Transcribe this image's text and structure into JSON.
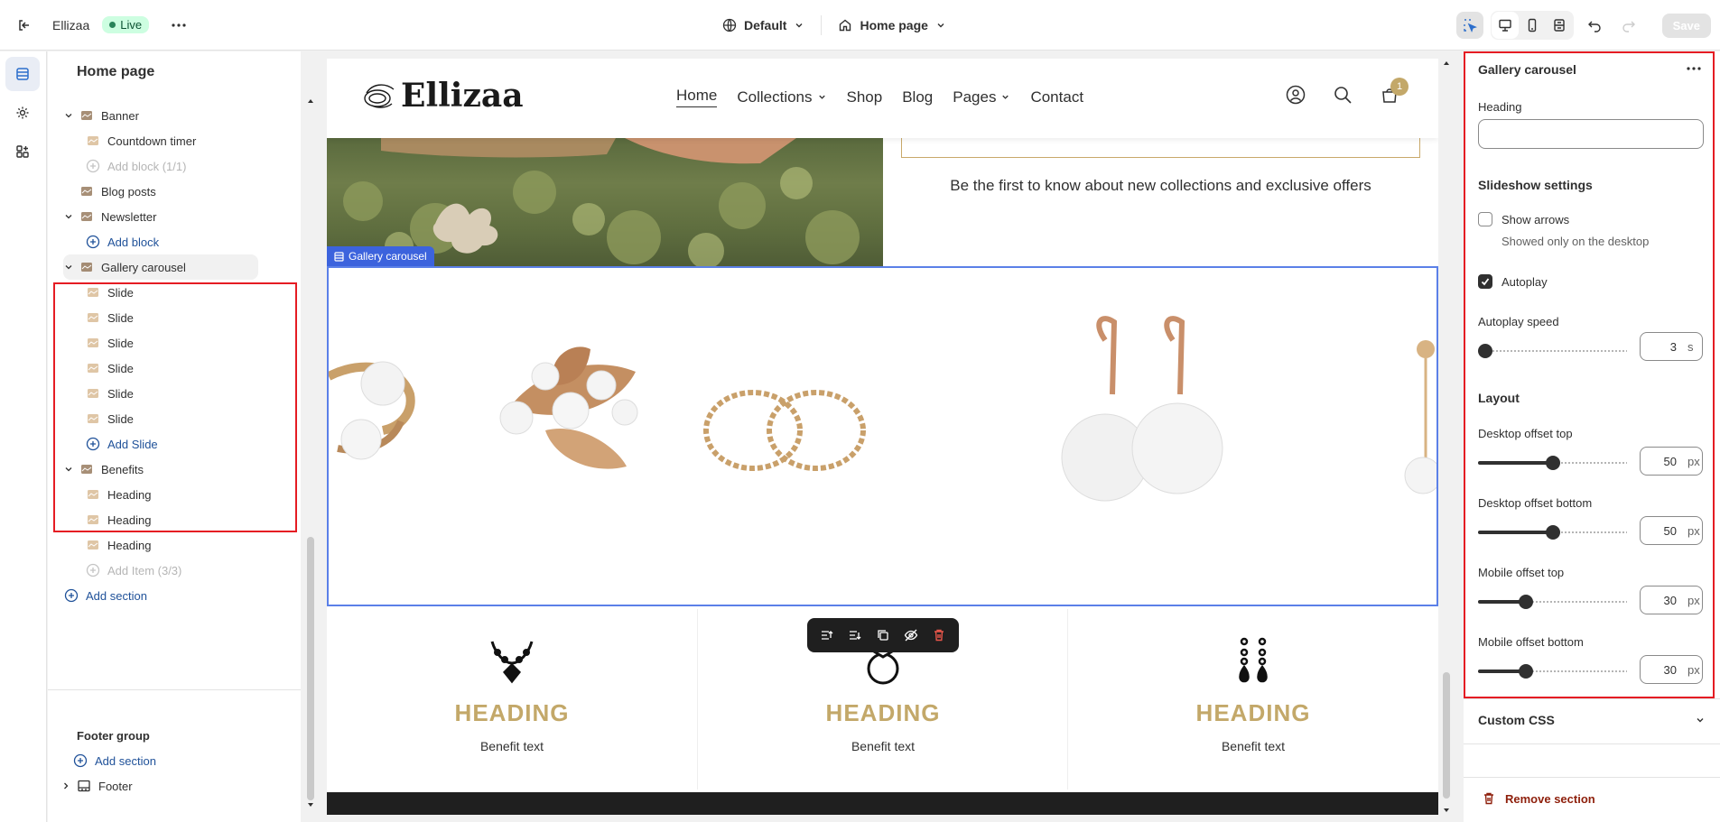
{
  "topbar": {
    "store_name": "Ellizaa",
    "status": "Live",
    "theme": "Default",
    "page": "Home page",
    "save_label": "Save"
  },
  "sidebar": {
    "title": "Home page",
    "items": [
      {
        "label": "Banner",
        "level": 0,
        "type": "section",
        "expanded": true
      },
      {
        "label": "Countdown timer",
        "level": 1,
        "type": "block"
      },
      {
        "label": "Add block (1/1)",
        "level": 1,
        "type": "add-disabled"
      },
      {
        "label": "Blog posts",
        "level": 0,
        "type": "section"
      },
      {
        "label": "Newsletter",
        "level": 0,
        "type": "section",
        "expanded": true
      },
      {
        "label": "Add block",
        "level": 1,
        "type": "add"
      },
      {
        "label": "Gallery carousel",
        "level": 0,
        "type": "section",
        "expanded": true,
        "selected": true
      },
      {
        "label": "Slide",
        "level": 1,
        "type": "block"
      },
      {
        "label": "Slide",
        "level": 1,
        "type": "block"
      },
      {
        "label": "Slide",
        "level": 1,
        "type": "block"
      },
      {
        "label": "Slide",
        "level": 1,
        "type": "block"
      },
      {
        "label": "Slide",
        "level": 1,
        "type": "block"
      },
      {
        "label": "Slide",
        "level": 1,
        "type": "block"
      },
      {
        "label": "Add Slide",
        "level": 1,
        "type": "add"
      },
      {
        "label": "Benefits",
        "level": 0,
        "type": "section",
        "expanded": true
      },
      {
        "label": "Heading",
        "level": 1,
        "type": "block"
      },
      {
        "label": "Heading",
        "level": 1,
        "type": "block"
      },
      {
        "label": "Heading",
        "level": 1,
        "type": "block"
      },
      {
        "label": "Add Item (3/3)",
        "level": 1,
        "type": "add-disabled"
      },
      {
        "label": "Add section",
        "level": 0,
        "type": "add"
      }
    ],
    "footer_group_title": "Footer group",
    "footer_add_section": "Add section",
    "footer_item": "Footer"
  },
  "preview": {
    "logo": "Ellizaa",
    "nav": [
      "Home",
      "Collections",
      "Shop",
      "Blog",
      "Pages",
      "Contact"
    ],
    "cart_count": "1",
    "newsletter_text": "Be the first to know about new collections and exclusive offers",
    "gallery_label": "Gallery carousel",
    "benefits": [
      {
        "heading": "HEADING",
        "text": "Benefit text",
        "icon": "necklace-icon"
      },
      {
        "heading": "HEADING",
        "text": "Benefit text",
        "icon": "ring-icon"
      },
      {
        "heading": "HEADING",
        "text": "Benefit text",
        "icon": "earrings-icon"
      }
    ]
  },
  "settings": {
    "title": "Gallery carousel",
    "heading_label": "Heading",
    "heading_value": "",
    "slideshow_title": "Slideshow settings",
    "show_arrows_label": "Show arrows",
    "show_arrows_help": "Showed only on the desktop",
    "show_arrows_checked": false,
    "autoplay_label": "Autoplay",
    "autoplay_checked": true,
    "autoplay_speed_label": "Autoplay speed",
    "autoplay_speed_value": "3",
    "autoplay_speed_unit": "s",
    "layout_title": "Layout",
    "desktop_top_label": "Desktop offset top",
    "desktop_top_value": "50",
    "desktop_bottom_label": "Desktop offset bottom",
    "desktop_bottom_value": "50",
    "mobile_top_label": "Mobile offset top",
    "mobile_top_value": "30",
    "mobile_bottom_label": "Mobile offset bottom",
    "mobile_bottom_value": "30",
    "px_unit": "px",
    "custom_css_label": "Custom CSS",
    "remove_label": "Remove section"
  },
  "colors": {
    "accent_blue": "#3c63dd",
    "highlight_red": "#e51c23",
    "gold": "#c3a869",
    "danger": "#8e1f0b"
  }
}
